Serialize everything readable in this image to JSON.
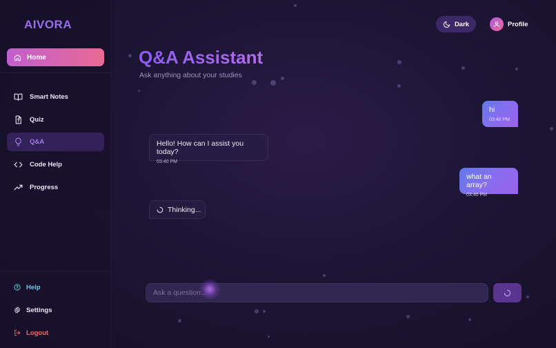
{
  "app": {
    "brand": "AIVORA"
  },
  "sidebar": {
    "home": "Home",
    "items": [
      {
        "label": "Smart Notes",
        "icon": "book-open-icon"
      },
      {
        "label": "Quiz",
        "icon": "quiz-file-icon"
      },
      {
        "label": "Q&A",
        "icon": "lightbulb-icon",
        "active": true
      },
      {
        "label": "Code Help",
        "icon": "code-icon"
      },
      {
        "label": "Progress",
        "icon": "trending-up-icon"
      }
    ],
    "bottom": [
      {
        "label": "Help",
        "icon": "help-circle-icon",
        "color": "#5fd3e8"
      },
      {
        "label": "Settings",
        "icon": "gear-icon",
        "color": "#ece7f7"
      },
      {
        "label": "Logout",
        "icon": "logout-icon",
        "color": "#f06a6a"
      }
    ]
  },
  "header": {
    "theme_label": "Dark",
    "profile_label": "Profile"
  },
  "page": {
    "title": "Q&A Assistant",
    "subtitle": "Ask anything about your studies"
  },
  "messages": [
    {
      "role": "user",
      "text": "hi",
      "time": "03:40 PM"
    },
    {
      "role": "assistant",
      "text": "Hello! How can I assist you today?",
      "time": "03:40 PM"
    },
    {
      "role": "user",
      "text": "what an array?",
      "time": "03:40 PM"
    }
  ],
  "thinking": "Thinking...",
  "input": {
    "placeholder": "Ask a question...",
    "value": ""
  },
  "colors": {
    "accent": "#9a6cf0",
    "home_gradient_start": "#c25fd0",
    "home_gradient_end": "#e86a93",
    "user_bubble": "#7a70ee"
  }
}
